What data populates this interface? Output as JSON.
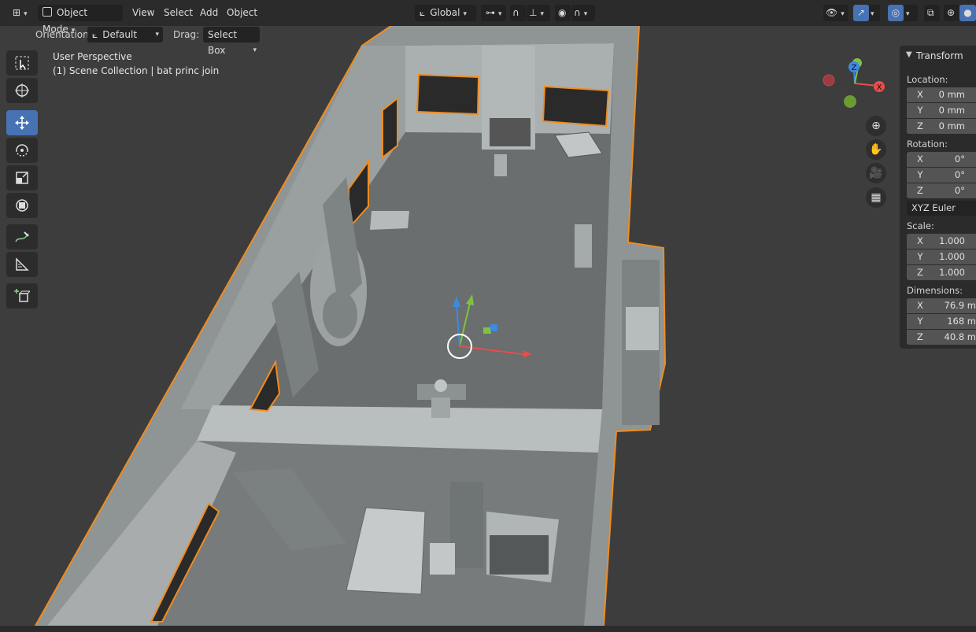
{
  "header": {
    "mode_label": "Object Mode",
    "menus": [
      "View",
      "Select",
      "Add",
      "Object"
    ],
    "orientation_global": "Global"
  },
  "toolheader": {
    "orientation_label": "Orientation:",
    "orientation_value": "Default",
    "drag_label": "Drag:",
    "drag_value": "Select Box"
  },
  "viewport": {
    "perspective": "User Perspective",
    "collection": "(1) Scene Collection | bat princ join",
    "accent": "#f08c20",
    "gizmo": {
      "x": "X",
      "y": "Y",
      "z": "Z"
    }
  },
  "toolbar": {
    "tools": [
      "select-box-icon",
      "cursor-icon",
      "move-icon",
      "rotate-icon",
      "scale-icon",
      "transform-icon",
      "annotate-icon",
      "measure-icon",
      "add-cube-icon"
    ],
    "active": "move-icon",
    "active_color": "#4772b3"
  },
  "transform": {
    "title": "Transform",
    "location_label": "Location:",
    "location": [
      {
        "axis": "X",
        "value": "0 mm"
      },
      {
        "axis": "Y",
        "value": "0 mm"
      },
      {
        "axis": "Z",
        "value": "0 mm"
      }
    ],
    "rotation_label": "Rotation:",
    "rotation": [
      {
        "axis": "X",
        "value": "0°"
      },
      {
        "axis": "Y",
        "value": "0°"
      },
      {
        "axis": "Z",
        "value": "0°"
      }
    ],
    "rotation_mode": "XYZ Euler",
    "scale_label": "Scale:",
    "scale": [
      {
        "axis": "X",
        "value": "1.000"
      },
      {
        "axis": "Y",
        "value": "1.000"
      },
      {
        "axis": "Z",
        "value": "1.000"
      }
    ],
    "dimensions_label": "Dimensions:",
    "dimensions": [
      {
        "axis": "X",
        "value": "76.9 m"
      },
      {
        "axis": "Y",
        "value": "168 m"
      },
      {
        "axis": "Z",
        "value": "40.8 m"
      }
    ]
  }
}
